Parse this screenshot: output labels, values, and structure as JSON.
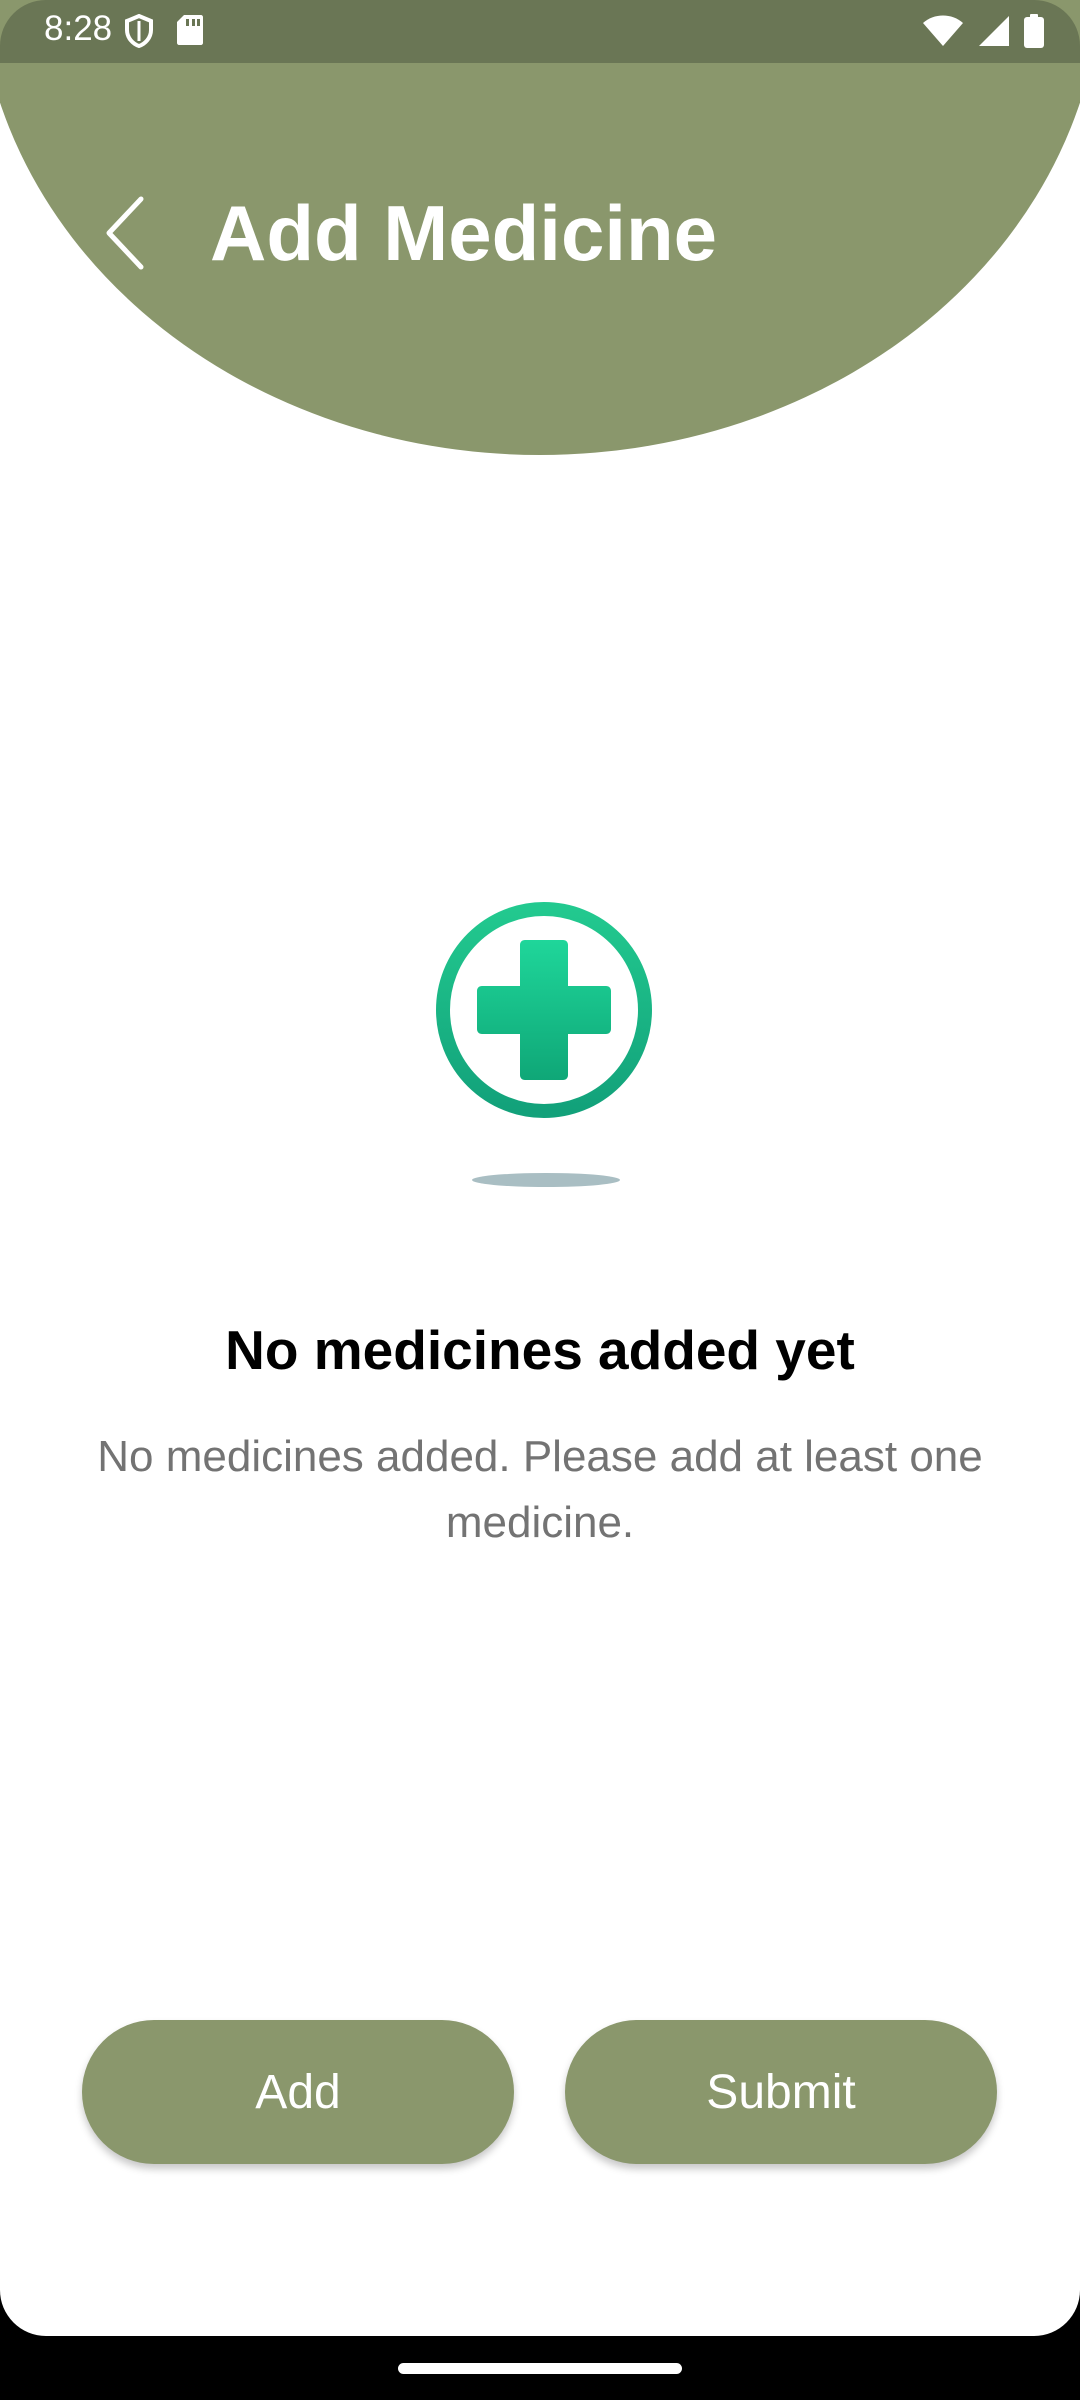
{
  "status_bar": {
    "time": "8:28",
    "left_icons": [
      "shield-icon",
      "sd-card-icon"
    ],
    "right_icons": [
      "wifi-icon",
      "signal-icon",
      "battery-icon"
    ]
  },
  "header": {
    "title": "Add Medicine",
    "back_icon": "chevron-left-icon",
    "color": "#8a976c"
  },
  "empty_state": {
    "icon": "medical-plus-icon",
    "title": "No medicines added yet",
    "description": "No medicines added. Please add at least one medicine."
  },
  "actions": {
    "add_label": "Add",
    "submit_label": "Submit"
  },
  "colors": {
    "accent": "#8a976c",
    "status_bar": "#6a7655",
    "icon_green": "#1ec98f"
  }
}
